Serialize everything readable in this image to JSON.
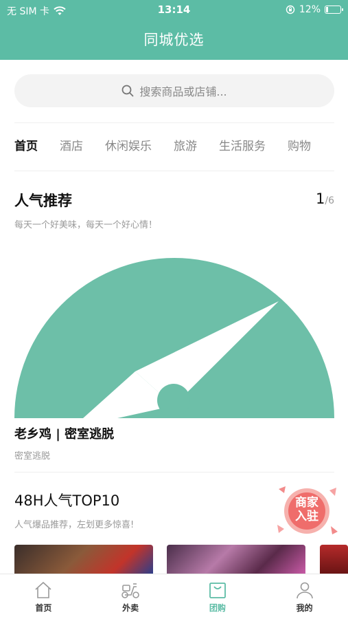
{
  "status_bar": {
    "carrier": "无 SIM 卡",
    "time": "13:14",
    "battery": "12%"
  },
  "nav": {
    "title": "同城优选"
  },
  "search": {
    "placeholder": "搜索商品或店铺..."
  },
  "categories": [
    {
      "label": "首页",
      "active": true
    },
    {
      "label": "酒店",
      "active": false
    },
    {
      "label": "休闲娱乐",
      "active": false
    },
    {
      "label": "旅游",
      "active": false
    },
    {
      "label": "生活服务",
      "active": false
    },
    {
      "label": "购物",
      "active": false
    }
  ],
  "popular": {
    "title": "人气推荐",
    "subtitle": "每天一个好美味，每天一个好心情！",
    "page_current": "1",
    "page_total": "/6",
    "item_title": "老乡鸡 | 密室逃脱",
    "item_subtitle": "密室逃脱",
    "banner_color": "#6dbfa8"
  },
  "top10": {
    "title": "48H人气TOP10",
    "subtitle": "人气爆品推荐，左划更多惊喜!"
  },
  "merchant_badge": {
    "line1": "商家",
    "line2": "入驻"
  },
  "tabbar": [
    {
      "label": "首页",
      "icon": "home-icon",
      "active": false
    },
    {
      "label": "外卖",
      "icon": "scooter-icon",
      "active": false
    },
    {
      "label": "团购",
      "icon": "bag-icon",
      "active": true
    },
    {
      "label": "我的",
      "icon": "user-icon",
      "active": false
    }
  ],
  "colors": {
    "accent": "#5cbca5"
  }
}
